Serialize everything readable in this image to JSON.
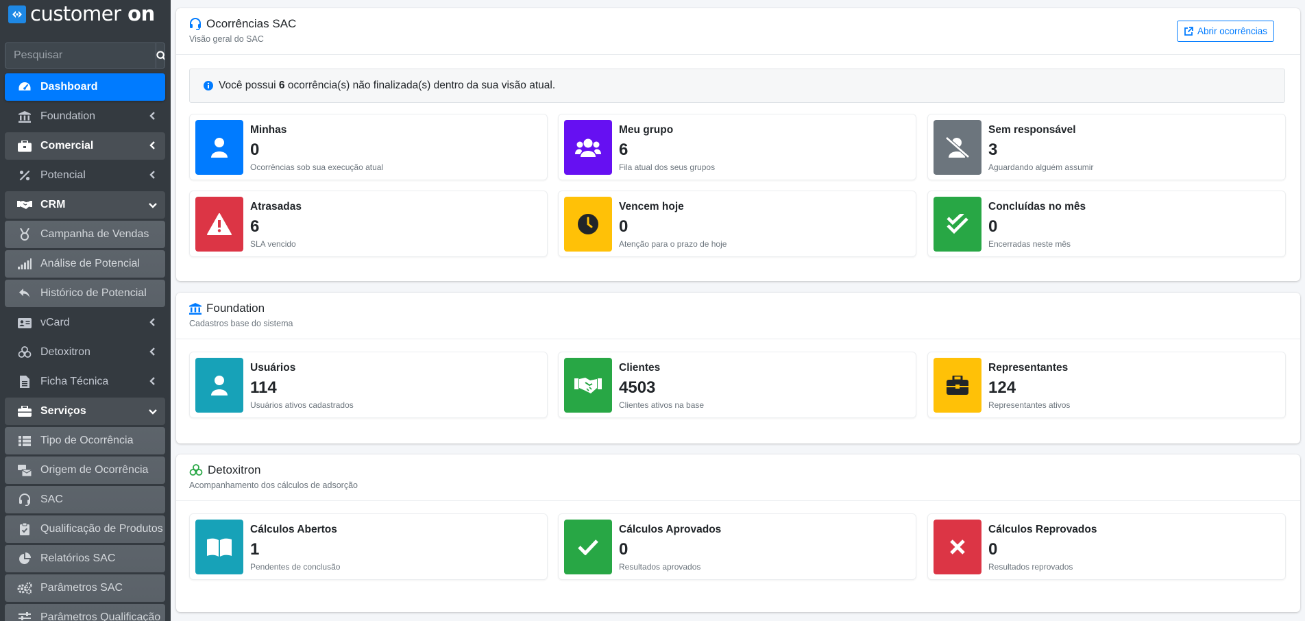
{
  "brand": {
    "name_part1": "customer",
    "name_part2": "on"
  },
  "search": {
    "placeholder": "Pesquisar"
  },
  "sidebar": {
    "items": [
      {
        "label": "Dashboard"
      },
      {
        "label": "Foundation"
      },
      {
        "label": "Comercial"
      },
      {
        "label": "Potencial"
      },
      {
        "label": "CRM"
      },
      {
        "label": "Campanha de Vendas"
      },
      {
        "label": "Análise de Potencial"
      },
      {
        "label": "Histórico de Potencial"
      },
      {
        "label": "vCard"
      },
      {
        "label": "Detoxitron"
      },
      {
        "label": "Ficha Técnica"
      },
      {
        "label": "Serviços"
      },
      {
        "label": "Tipo de Ocorrência"
      },
      {
        "label": "Origem de Ocorrência"
      },
      {
        "label": "SAC"
      },
      {
        "label": "Qualificação de Produtos"
      },
      {
        "label": "Relatórios SAC"
      },
      {
        "label": "Parâmetros SAC"
      },
      {
        "label": "Parâmetros Qualificação"
      }
    ]
  },
  "sac": {
    "title": "Ocorrências SAC",
    "subtitle": "Visão geral do SAC",
    "open_button": "Abrir ocorrências",
    "alert": {
      "prefix": "Você possui ",
      "count": "6",
      "suffix": " ocorrência(s) não finalizada(s) dentro da sua visão atual."
    },
    "boxes": [
      {
        "title": "Minhas",
        "value": "0",
        "desc": "Ocorrências sob sua execução atual"
      },
      {
        "title": "Meu grupo",
        "value": "6",
        "desc": "Fila atual dos seus grupos"
      },
      {
        "title": "Sem responsável",
        "value": "3",
        "desc": "Aguardando alguém assumir"
      },
      {
        "title": "Atrasadas",
        "value": "6",
        "desc": "SLA vencido"
      },
      {
        "title": "Vencem hoje",
        "value": "0",
        "desc": "Atenção para o prazo de hoje"
      },
      {
        "title": "Concluídas no mês",
        "value": "0",
        "desc": "Encerradas neste mês"
      }
    ]
  },
  "foundation": {
    "title": "Foundation",
    "subtitle": "Cadastros base do sistema",
    "boxes": [
      {
        "title": "Usuários",
        "value": "114",
        "desc": "Usuários ativos cadastrados"
      },
      {
        "title": "Clientes",
        "value": "4503",
        "desc": "Clientes ativos na base"
      },
      {
        "title": "Representantes",
        "value": "124",
        "desc": "Representantes ativos"
      }
    ]
  },
  "detox": {
    "title": "Detoxitron",
    "subtitle": "Acompanhamento dos cálculos de adsorção",
    "boxes": [
      {
        "title": "Cálculos Abertos",
        "value": "1",
        "desc": "Pendentes de conclusão"
      },
      {
        "title": "Cálculos Aprovados",
        "value": "0",
        "desc": "Resultados aprovados"
      },
      {
        "title": "Cálculos Reprovados",
        "value": "0",
        "desc": "Resultados reprovados"
      }
    ]
  },
  "colors": {
    "primary": "#007bff",
    "sidebar": "#343a40",
    "purple": "#6610f2",
    "gray": "#6c757d",
    "red": "#dc3545",
    "yellow": "#ffc107",
    "green": "#28a745",
    "teal": "#17a2b8"
  }
}
